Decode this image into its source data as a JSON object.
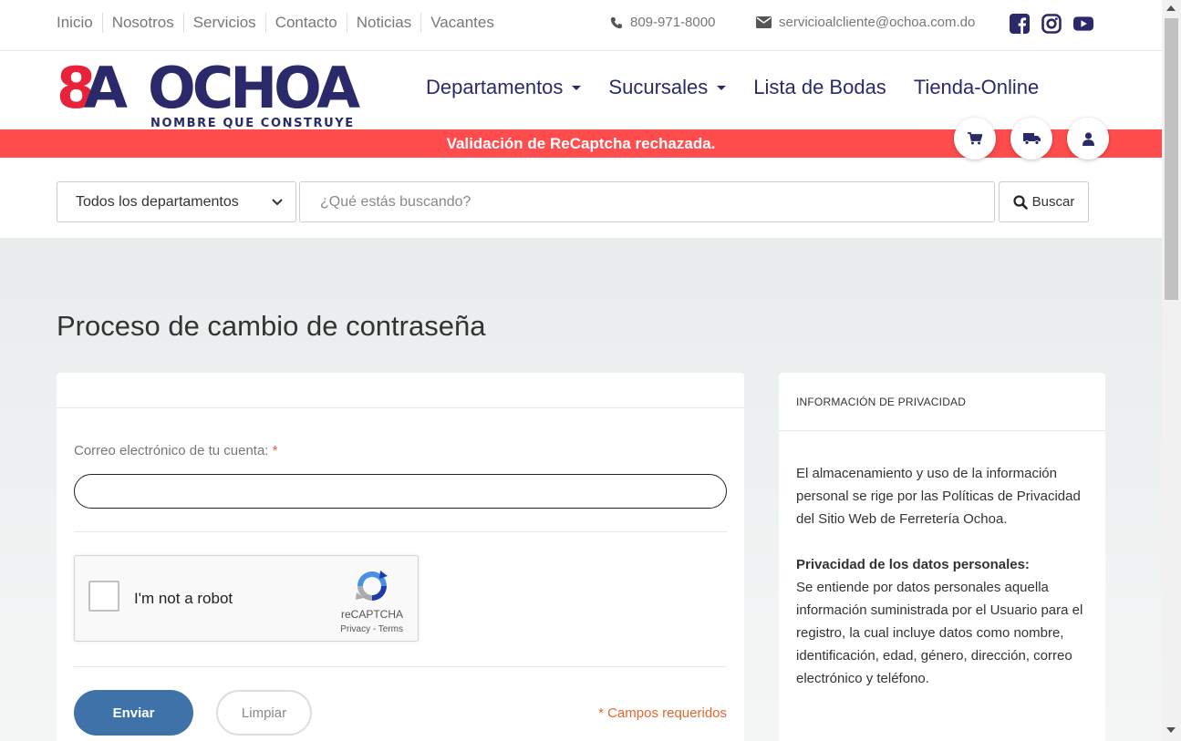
{
  "topbar": {
    "nav": [
      "Inicio",
      "Nosotros",
      "Servicios",
      "Contacto",
      "Noticias",
      "Vacantes"
    ],
    "phone": "809-971-8000",
    "email": "servicioalcliente@ochoa.com.do",
    "social_icons": [
      "facebook-icon",
      "instagram-icon",
      "youtube-icon"
    ]
  },
  "header": {
    "logo_text": "8A OCHOA",
    "logo_tagline": "NOMBRE QUE CONSTRUYE",
    "nav": {
      "departamentos": "Departamentos",
      "sucursales": "Sucursales",
      "bodas": "Lista de Bodas",
      "tienda": "Tienda-Online"
    }
  },
  "alert": {
    "message": "Validación de ReCaptcha rechazada."
  },
  "search": {
    "department": "Todos los departamentos",
    "placeholder": "¿Qué estás buscando?",
    "button": "Buscar"
  },
  "main": {
    "title": "Proceso de cambio de contraseña",
    "form": {
      "email_label": "Correo electrónico de tu cuenta:",
      "required_mark": "*",
      "email_value": "",
      "recaptcha_label": "I'm not a robot",
      "recaptcha_brand": "reCAPTCHA",
      "recaptcha_links": "Privacy - Terms",
      "submit": "Enviar",
      "clear": "Limpiar",
      "required_note": "* Campos requeridos"
    },
    "privacy": {
      "heading": "INFORMACIÓN DE PRIVACIDAD",
      "p1": "El almacenamiento y uso de la información personal se rige por las Políticas de Privacidad del Sitio Web de Ferretería Ochoa.",
      "p2_title": "Privacidad de los datos personales:",
      "p2": "Se entiende por datos personales aquella información suministrada por el Usuario para el registro, la cual incluye datos como nombre, identificación, edad, género, dirección, correo electrónico y teléfono."
    }
  },
  "colors": {
    "brand_red": "#e8223a",
    "brand_navy": "#2a2a6b",
    "alert_bg": "#ff4c4c",
    "primary_button": "#3f72a9",
    "required": "#e8652b"
  }
}
